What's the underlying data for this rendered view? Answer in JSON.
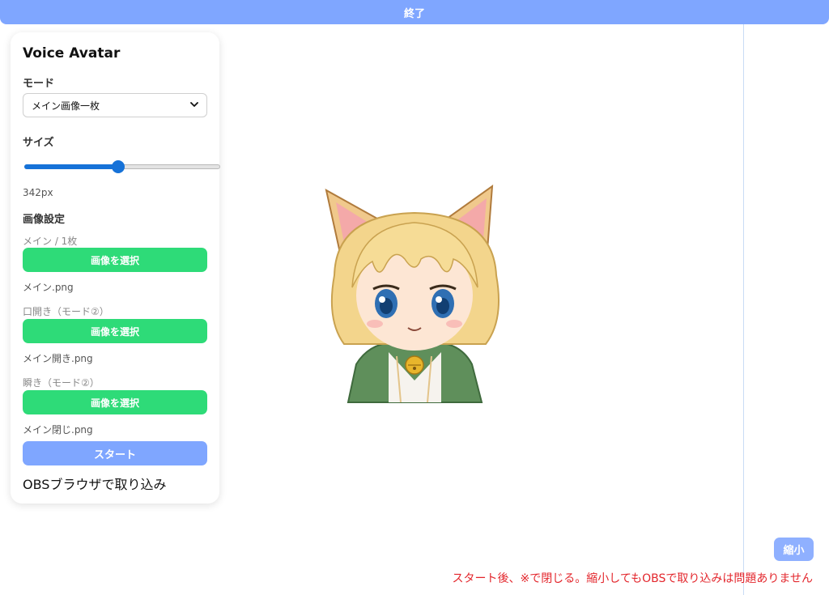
{
  "top_bar": {
    "label": "終了"
  },
  "panel": {
    "title": "Voice Avatar",
    "mode": {
      "label": "モード",
      "selected": "メイン画像一枚"
    },
    "size": {
      "label": "サイズ",
      "value_text": "342px",
      "slider_fraction": 0.48
    },
    "image_settings": {
      "label": "画像設定",
      "slots": [
        {
          "label": "メイン / 1枚",
          "button": "画像を選択",
          "file": "メイン.png"
        },
        {
          "label": "口開き（モード②）",
          "button": "画像を選択",
          "file": "メイン開き.png"
        },
        {
          "label": "瞬き（モード②）",
          "button": "画像を選択",
          "file": "メイン閉じ.png"
        }
      ]
    },
    "start_button": "スタート",
    "obs_text": "OBSブラウザで取り込み"
  },
  "shrink_button": "縮小",
  "notice": "スタート後、※で閉じる。縮小してもOBSで取り込みは問題ありません",
  "colors": {
    "accent_blue": "#7fa6ff",
    "button_green": "#2edb78",
    "slider_blue": "#1672d8",
    "notice_red": "#e3262c"
  },
  "icons": {
    "select_chevron": "chevron-down-icon",
    "avatar": "cat-girl-avatar-image"
  }
}
